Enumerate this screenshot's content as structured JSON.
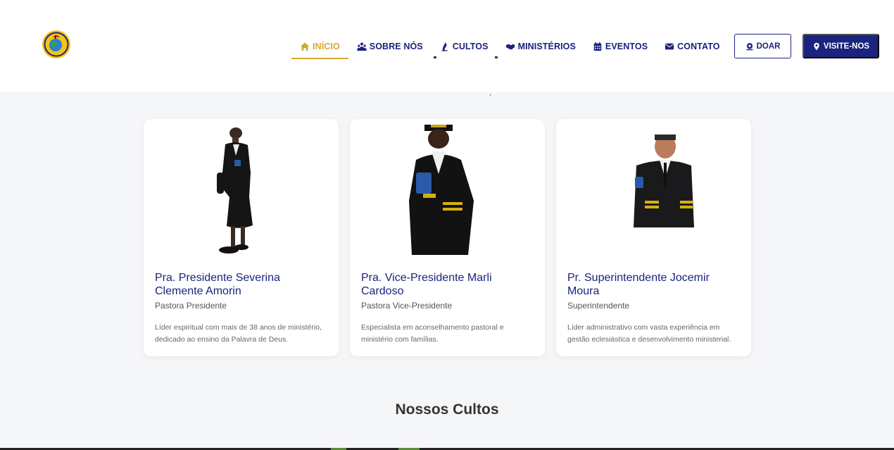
{
  "nav": {
    "items": [
      {
        "label": "INÍCIO",
        "icon": "home-icon"
      },
      {
        "label": "SOBRE NÓS",
        "icon": "people-icon"
      },
      {
        "label": "CULTOS",
        "icon": "hands-icon"
      },
      {
        "label": "MINISTÉRIOS",
        "icon": "handshake-icon"
      },
      {
        "label": "EVENTOS",
        "icon": "calendar-icon"
      },
      {
        "label": "CONTATO",
        "icon": "envelope-icon"
      }
    ],
    "active_index": 0
  },
  "buttons": {
    "doar": "DOAR",
    "visite": "VISITE-NOS"
  },
  "colors": {
    "primary": "#1a237e",
    "accent": "#d4a82a",
    "background": "#f5f6f8"
  },
  "leaders": [
    {
      "name": "Pra. Presidente Severina Clemente Amorin",
      "role": "Pastora Presidente",
      "description": "Líder espiritual com mais de 38 anos de ministério, dedicado ao ensino da Palavra de Deus."
    },
    {
      "name": "Pra. Vice-Presidente Marli Cardoso",
      "role": "Pastora Vice-Presidente",
      "description": "Especialista em aconselhamento pastoral e ministério com famílias."
    },
    {
      "name": "Pr. Superintendente Jocemir Moura",
      "role": "Superintendente",
      "description": "Líder administrativo com vasta experiência em gestão eclesiástica e desenvolvimento ministerial."
    }
  ],
  "sections": {
    "cultos_title": "Nossos Cultos"
  }
}
